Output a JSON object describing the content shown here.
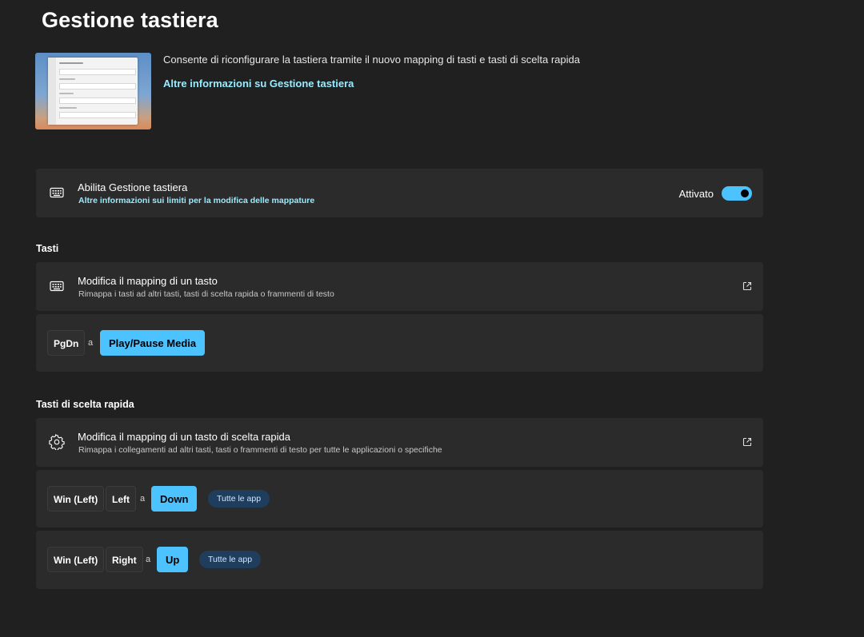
{
  "page": {
    "title": "Gestione tastiera"
  },
  "hero": {
    "description": "Consente di riconfigurare la tastiera tramite il nuovo mapping di tasti e tasti di scelta rapida",
    "link": "Altre informazioni su Gestione tastiera"
  },
  "enable_card": {
    "icon": "keyboard-icon",
    "title": "Abilita Gestione tastiera",
    "link": "Altre informazioni sui limiti per la modifica delle mappature",
    "toggle_label": "Attivato",
    "toggle_on": true
  },
  "keys_section": {
    "title": "Tasti",
    "card": {
      "icon": "keyboard-icon",
      "title": "Modifica il mapping di un tasto",
      "subtitle": "Rimappa i tasti ad altri tasti, tasti di scelta rapida o frammenti di testo",
      "action_icon": "open-external-icon"
    },
    "mappings": [
      {
        "from": [
          "PgDn"
        ],
        "separator": "a",
        "to": "Play/Pause Media"
      }
    ]
  },
  "shortcuts_section": {
    "title": "Tasti di scelta rapida",
    "card": {
      "icon": "gear-icon",
      "title": "Modifica il mapping di un tasto di scelta rapida",
      "subtitle": "Rimappa i collegamenti ad altri tasti, tasti o frammenti di testo per tutte le applicazioni o specifiche",
      "action_icon": "open-external-icon"
    },
    "mappings": [
      {
        "from": [
          "Win (Left)",
          "Left"
        ],
        "separator": "a",
        "to": "Down",
        "scope": "Tutte le app"
      },
      {
        "from": [
          "Win (Left)",
          "Right"
        ],
        "separator": "a",
        "to": "Up",
        "scope": "Tutte le app"
      }
    ]
  },
  "colors": {
    "background": "#202020",
    "card": "#2b2b2b",
    "accent": "#4cc2ff",
    "link": "#99ebff",
    "pill": "#1f3d5c"
  }
}
